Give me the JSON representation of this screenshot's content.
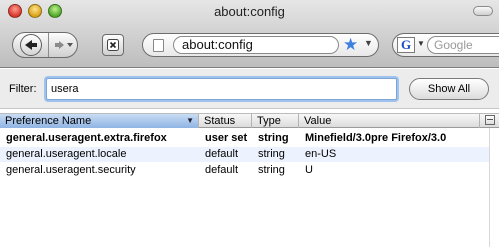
{
  "window": {
    "title": "about:config"
  },
  "toolbar": {
    "url": "about:config",
    "search_placeholder": "Google"
  },
  "filter": {
    "label": "Filter:",
    "value": "usera",
    "show_all": "Show All"
  },
  "table": {
    "columns": [
      "Preference Name",
      "Status",
      "Type",
      "Value"
    ],
    "rows": [
      {
        "name": "general.useragent.extra.firefox",
        "status": "user set",
        "type": "string",
        "value": "Minefield/3.0pre Firefox/3.0",
        "bold": true
      },
      {
        "name": "general.useragent.locale",
        "status": "default",
        "type": "string",
        "value": "en-US",
        "bold": false
      },
      {
        "name": "general.useragent.security",
        "status": "default",
        "type": "string",
        "value": "U",
        "bold": false
      }
    ]
  },
  "colors": {
    "accent": "#3f7fe0",
    "sort_header": "#a9c7ee",
    "alt_row": "#edf3fe"
  },
  "icons": [
    "back-arrow-icon",
    "forward-arrow-icon",
    "stop-icon",
    "page-icon",
    "bookmark-star-icon",
    "dropdown-icon",
    "google-icon",
    "sort-descending-icon",
    "column-picker-icon"
  ]
}
